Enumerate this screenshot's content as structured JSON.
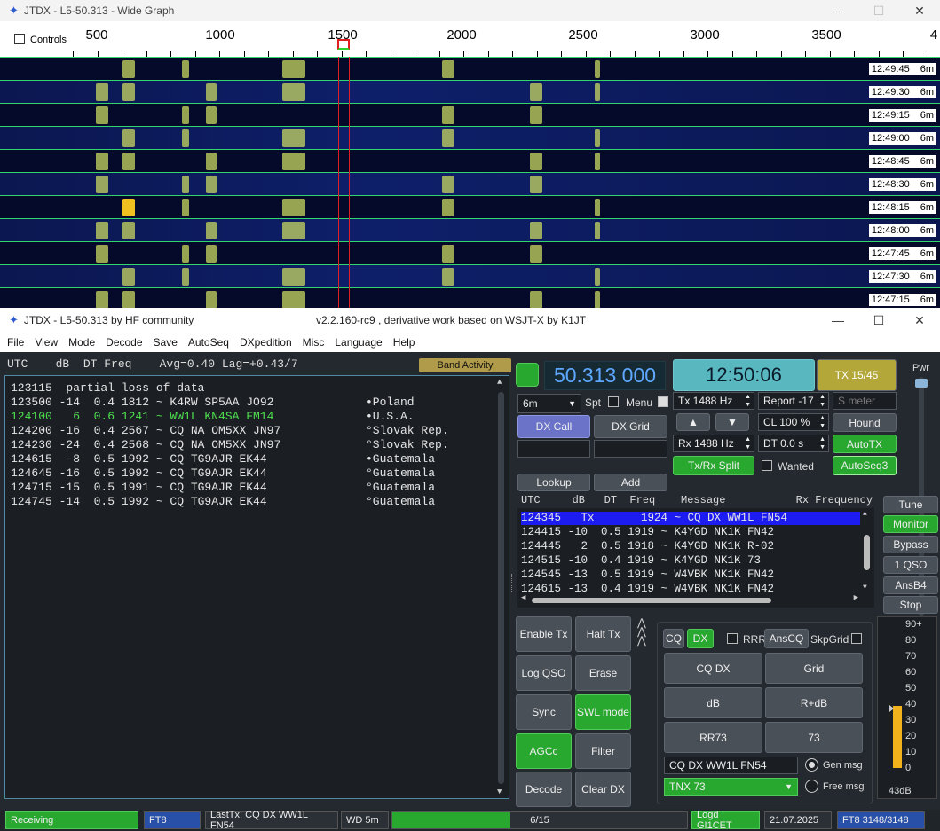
{
  "wide": {
    "title": "JTDX - L5-50.313 - Wide Graph",
    "controls_label": "Controls",
    "scale": [
      "500",
      "1000",
      "1500",
      "2000",
      "2500",
      "3000",
      "3500",
      "4"
    ],
    "rows": [
      {
        "time": "12:49:45",
        "band": "6m"
      },
      {
        "time": "12:49:30",
        "band": "6m"
      },
      {
        "time": "12:49:15",
        "band": "6m"
      },
      {
        "time": "12:49:00",
        "band": "6m"
      },
      {
        "time": "12:48:45",
        "band": "6m"
      },
      {
        "time": "12:48:30",
        "band": "6m"
      },
      {
        "time": "12:48:15",
        "band": "6m"
      },
      {
        "time": "12:48:00",
        "band": "6m"
      },
      {
        "time": "12:47:45",
        "band": "6m"
      },
      {
        "time": "12:47:30",
        "band": "6m"
      },
      {
        "time": "12:47:15",
        "band": "6m"
      }
    ]
  },
  "main": {
    "title": "JTDX - L5-50.313  by HF community",
    "version": "v2.2.160-rc9 , derivative work based on WSJT-X by K1JT",
    "menu": [
      "File",
      "View",
      "Mode",
      "Decode",
      "Save",
      "AutoSeq",
      "DXpedition",
      "Misc",
      "Language",
      "Help"
    ],
    "header": "UTC    dB  DT Freq    Avg=0.40 Lag=+0.43/7",
    "band_activity": "Band Activity",
    "decodes": [
      {
        "text": "123115  partial loss of data",
        "country": "",
        "color": "#e5e5e5"
      },
      {
        "text": "123500 -14  0.4 1812 ~ K4RW SP5AA JO92",
        "country": "•Poland",
        "color": "#e5e5e5"
      },
      {
        "text": "124100   6  0.6 1241 ~ WW1L KN4SA FM14",
        "country": "•U.S.A.",
        "color": "#4fe04f"
      },
      {
        "text": "124200 -16  0.4 2567 ~ CQ NA OM5XX JN97",
        "country": "°Slovak Rep.",
        "color": "#e5e5e5"
      },
      {
        "text": "124230 -24  0.4 2568 ~ CQ NA OM5XX JN97",
        "country": "°Slovak Rep.",
        "color": "#e5e5e5"
      },
      {
        "text": "124615  -8  0.5 1992 ~ CQ TG9AJR EK44",
        "country": "•Guatemala",
        "color": "#e5e5e5"
      },
      {
        "text": "124645 -16  0.5 1992 ~ CQ TG9AJR EK44",
        "country": "°Guatemala",
        "color": "#e5e5e5"
      },
      {
        "text": "124715 -15  0.5 1991 ~ CQ TG9AJR EK44",
        "country": "°Guatemala",
        "color": "#e5e5e5"
      },
      {
        "text": "124745 -14  0.5 1992 ~ CQ TG9AJR EK44",
        "country": "°Guatemala",
        "color": "#e5e5e5"
      }
    ],
    "frequency": "50.313 000",
    "clock": "12:50:06",
    "tx_period": "TX 15/45",
    "pwr": "Pwr",
    "band": "6m",
    "spt": "Spt",
    "menu_chk": "Menu",
    "tx_hz": "Tx  1488  Hz",
    "rx_hz": "Rx  1488  Hz",
    "report": "Report -17",
    "smeter": "S meter",
    "cl": "CL  100 %",
    "dt": "DT 0.0 s",
    "hound": "Hound",
    "autotx": "AutoTX",
    "autoseq3": "AutoSeq3",
    "txrx_split": "Tx/Rx Split",
    "wanted": "Wanted",
    "dx_call": "DX Call",
    "dx_grid": "DX Grid",
    "lookup": "Lookup",
    "add": "Add",
    "list_header": "UTC     dB   DT  Freq    Message           Rx Frequency",
    "list": [
      "124345   Tx       1924 ~ CQ DX WW1L FN54",
      "124415 -10  0.5 1919 ~ K4YGD NK1K FN42",
      "124445   2  0.5 1918 ~ K4YGD NK1K R-02",
      "124515 -10  0.4 1919 ~ K4YGD NK1K 73",
      "124545 -13  0.5 1919 ~ W4VBK NK1K FN42",
      "124615 -13  0.4 1919 ~ W4VBK NK1K FN42"
    ],
    "side": [
      "Tune",
      "Monitor",
      "Bypass",
      "1 QSO",
      "AnsB4",
      "Stop"
    ],
    "left_btns": [
      "Enable Tx",
      "Halt Tx",
      "Log QSO",
      "Erase",
      "Sync",
      "SWL mode",
      "AGCc",
      "Filter",
      "Decode",
      "Clear DX"
    ],
    "cq": "CQ",
    "dx": "DX",
    "rrr": "RRR",
    "anscq": "AnsCQ",
    "skpgrid": "SkpGrid",
    "msg_btns": [
      "CQ DX",
      "Grid",
      "dB",
      "R+dB",
      "RR73",
      "73"
    ],
    "gen_text": "CQ DX WW1L FN54",
    "gen_msg": "Gen msg",
    "free_text": "TNX 73",
    "free_msg": "Free msg",
    "meter_scale": [
      "90+",
      "80",
      "70",
      "60",
      "50",
      "40",
      "30",
      "20",
      "10",
      "0"
    ],
    "meter_val": "43dB",
    "meter_level": 0.43,
    "status": {
      "receiving": "Receiving",
      "mode": "FT8",
      "lasttx": "LastTx: CQ DX WW1L FN54",
      "wd": "WD 5m",
      "progress": "6/15",
      "progress_frac": 0.4,
      "logd": "Logd GI1CET",
      "date": "21.07.2025",
      "ft8": "FT8  3148/3148"
    }
  }
}
